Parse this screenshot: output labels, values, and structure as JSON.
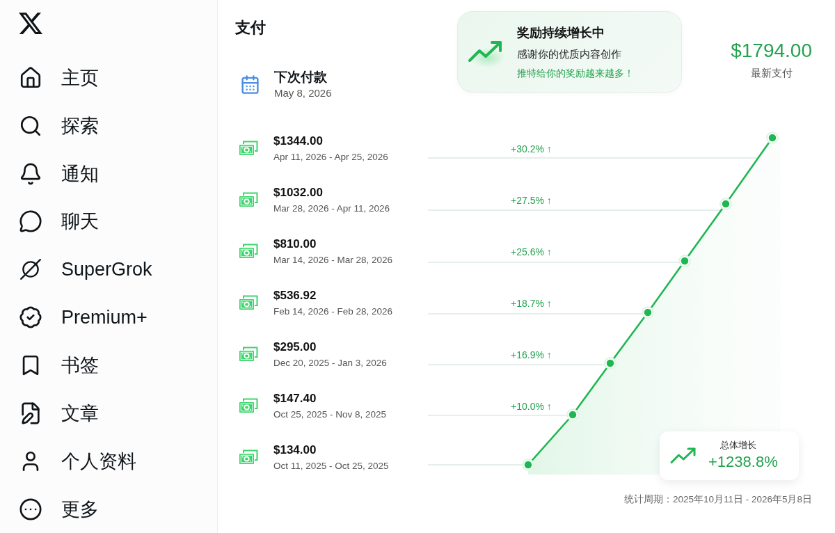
{
  "sidebar": {
    "items": [
      {
        "label": "主页"
      },
      {
        "label": "探索"
      },
      {
        "label": "通知"
      },
      {
        "label": "聊天"
      },
      {
        "label": "SuperGrok"
      },
      {
        "label": "Premium+"
      },
      {
        "label": "书签"
      },
      {
        "label": "文章"
      },
      {
        "label": "个人资料"
      },
      {
        "label": "更多"
      }
    ]
  },
  "page": {
    "title": "支付"
  },
  "next_payment": {
    "label": "下次付款",
    "date": "May 8, 2026"
  },
  "banner": {
    "title": "奖励持续增长中",
    "subtitle": "感谢你的优质内容创作",
    "highlight": "推特给你的奖励越来越多！"
  },
  "latest_payment": {
    "amount": "$1794.00",
    "label": "最新支付"
  },
  "payments": [
    {
      "amount": "$1344.00",
      "period": "Apr 11, 2026 - Apr 25, 2026",
      "growth": "+30.2% ↑"
    },
    {
      "amount": "$1032.00",
      "period": "Mar 28, 2026 - Apr 11, 2026",
      "growth": "+27.5% ↑"
    },
    {
      "amount": "$810.00",
      "period": "Mar 14, 2026 - Mar 28, 2026",
      "growth": "+25.6% ↑"
    },
    {
      "amount": "$536.92",
      "period": "Feb 14, 2026 - Feb 28, 2026",
      "growth": "+18.7% ↑"
    },
    {
      "amount": "$295.00",
      "period": "Dec 20, 2025 - Jan 3, 2026",
      "growth": "+16.9% ↑"
    },
    {
      "amount": "$147.40",
      "period": "Oct 25, 2025 - Nov 8, 2025",
      "growth": "+10.0% ↑"
    },
    {
      "amount": "$134.00",
      "period": "Oct 11, 2025 - Oct 25, 2025"
    }
  ],
  "total_growth": {
    "label": "总体增长",
    "value": "+1238.8%"
  },
  "footer": {
    "period": "统计周期：2025年10月11日 - 2026年5月8日"
  }
}
